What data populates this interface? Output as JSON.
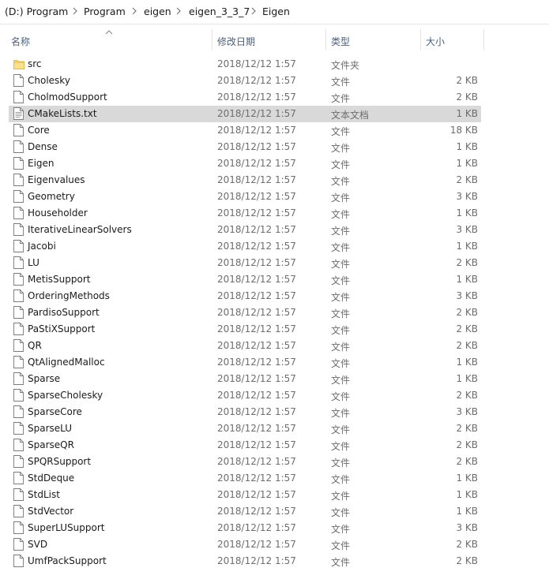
{
  "breadcrumb": {
    "items": [
      "(D:) Program",
      "Program",
      "eigen",
      "eigen_3_3_7",
      "Eigen"
    ]
  },
  "columns": {
    "name": "名称",
    "date": "修改日期",
    "type": "类型",
    "size": "大小"
  },
  "files": [
    {
      "name": "src",
      "date": "2018/12/12 1:57",
      "type": "文件夹",
      "size": "",
      "icon": "folder-icon"
    },
    {
      "name": "Cholesky",
      "date": "2018/12/12 1:57",
      "type": "文件",
      "size": "2 KB",
      "icon": "file-icon"
    },
    {
      "name": "CholmodSupport",
      "date": "2018/12/12 1:57",
      "type": "文件",
      "size": "2 KB",
      "icon": "file-icon"
    },
    {
      "name": "CMakeLists.txt",
      "date": "2018/12/12 1:57",
      "type": "文本文档",
      "size": "1 KB",
      "icon": "text-document-icon",
      "selected": true
    },
    {
      "name": "Core",
      "date": "2018/12/12 1:57",
      "type": "文件",
      "size": "18 KB",
      "icon": "file-icon"
    },
    {
      "name": "Dense",
      "date": "2018/12/12 1:57",
      "type": "文件",
      "size": "1 KB",
      "icon": "file-icon"
    },
    {
      "name": "Eigen",
      "date": "2018/12/12 1:57",
      "type": "文件",
      "size": "1 KB",
      "icon": "file-icon"
    },
    {
      "name": "Eigenvalues",
      "date": "2018/12/12 1:57",
      "type": "文件",
      "size": "2 KB",
      "icon": "file-icon"
    },
    {
      "name": "Geometry",
      "date": "2018/12/12 1:57",
      "type": "文件",
      "size": "3 KB",
      "icon": "file-icon"
    },
    {
      "name": "Householder",
      "date": "2018/12/12 1:57",
      "type": "文件",
      "size": "1 KB",
      "icon": "file-icon"
    },
    {
      "name": "IterativeLinearSolvers",
      "date": "2018/12/12 1:57",
      "type": "文件",
      "size": "3 KB",
      "icon": "file-icon"
    },
    {
      "name": "Jacobi",
      "date": "2018/12/12 1:57",
      "type": "文件",
      "size": "1 KB",
      "icon": "file-icon"
    },
    {
      "name": "LU",
      "date": "2018/12/12 1:57",
      "type": "文件",
      "size": "2 KB",
      "icon": "file-icon"
    },
    {
      "name": "MetisSupport",
      "date": "2018/12/12 1:57",
      "type": "文件",
      "size": "1 KB",
      "icon": "file-icon"
    },
    {
      "name": "OrderingMethods",
      "date": "2018/12/12 1:57",
      "type": "文件",
      "size": "3 KB",
      "icon": "file-icon"
    },
    {
      "name": "PardisoSupport",
      "date": "2018/12/12 1:57",
      "type": "文件",
      "size": "2 KB",
      "icon": "file-icon"
    },
    {
      "name": "PaStiXSupport",
      "date": "2018/12/12 1:57",
      "type": "文件",
      "size": "2 KB",
      "icon": "file-icon"
    },
    {
      "name": "QR",
      "date": "2018/12/12 1:57",
      "type": "文件",
      "size": "2 KB",
      "icon": "file-icon"
    },
    {
      "name": "QtAlignedMalloc",
      "date": "2018/12/12 1:57",
      "type": "文件",
      "size": "1 KB",
      "icon": "file-icon"
    },
    {
      "name": "Sparse",
      "date": "2018/12/12 1:57",
      "type": "文件",
      "size": "1 KB",
      "icon": "file-icon"
    },
    {
      "name": "SparseCholesky",
      "date": "2018/12/12 1:57",
      "type": "文件",
      "size": "2 KB",
      "icon": "file-icon"
    },
    {
      "name": "SparseCore",
      "date": "2018/12/12 1:57",
      "type": "文件",
      "size": "3 KB",
      "icon": "file-icon"
    },
    {
      "name": "SparseLU",
      "date": "2018/12/12 1:57",
      "type": "文件",
      "size": "2 KB",
      "icon": "file-icon"
    },
    {
      "name": "SparseQR",
      "date": "2018/12/12 1:57",
      "type": "文件",
      "size": "2 KB",
      "icon": "file-icon"
    },
    {
      "name": "SPQRSupport",
      "date": "2018/12/12 1:57",
      "type": "文件",
      "size": "2 KB",
      "icon": "file-icon"
    },
    {
      "name": "StdDeque",
      "date": "2018/12/12 1:57",
      "type": "文件",
      "size": "1 KB",
      "icon": "file-icon"
    },
    {
      "name": "StdList",
      "date": "2018/12/12 1:57",
      "type": "文件",
      "size": "1 KB",
      "icon": "file-icon"
    },
    {
      "name": "StdVector",
      "date": "2018/12/12 1:57",
      "type": "文件",
      "size": "1 KB",
      "icon": "file-icon"
    },
    {
      "name": "SuperLUSupport",
      "date": "2018/12/12 1:57",
      "type": "文件",
      "size": "3 KB",
      "icon": "file-icon"
    },
    {
      "name": "SVD",
      "date": "2018/12/12 1:57",
      "type": "文件",
      "size": "2 KB",
      "icon": "file-icon"
    },
    {
      "name": "UmfPackSupport",
      "date": "2018/12/12 1:57",
      "type": "文件",
      "size": "2 KB",
      "icon": "file-icon"
    }
  ],
  "colors": {
    "folder": "#f8d775",
    "selection": "#d9d9d9",
    "header_text": "#4c607a",
    "secondary_text": "#6d6d6d"
  }
}
